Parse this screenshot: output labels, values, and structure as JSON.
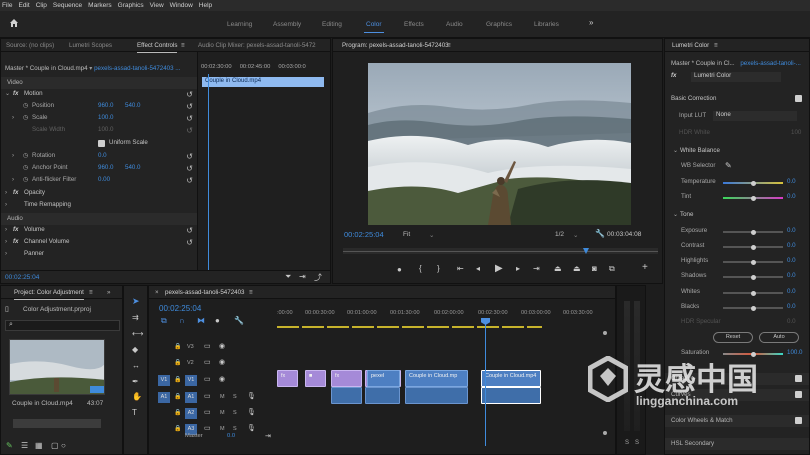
{
  "menu": [
    "File",
    "Edit",
    "Clip",
    "Sequence",
    "Markers",
    "Graphics",
    "View",
    "Window",
    "Help"
  ],
  "workspaces": [
    "Learning",
    "Assembly",
    "Editing",
    "Color",
    "Effects",
    "Audio",
    "Graphics",
    "Libraries"
  ],
  "workspace_active": "Color",
  "source_panel": {
    "tabs": [
      "Source: (no clips)",
      "Lumetri Scopes",
      "Effect Controls",
      "Audio Clip Mixer: pexels-assad-tanoli-5472"
    ],
    "master": "Master * Couple in Cloud.mp4",
    "seq": "pexels-assad-tanoli-5472403 ...",
    "mini_ruler": [
      "00:02:30:00",
      "00:02:45:00",
      "00:03:00:0"
    ],
    "mini_clip": "Couple in Cloud.mp4",
    "video_label": "Video",
    "audio_label": "Audio",
    "fx_label": "fx",
    "motion": "Motion",
    "position": "Position",
    "pos_x": "960.0",
    "pos_y": "540.0",
    "scale": "Scale",
    "scale_val": "100.0",
    "scale_width": "Scale Width",
    "scale_width_val": "100.0",
    "uniform_scale": "Uniform Scale",
    "rotation": "Rotation",
    "rotation_val": "0.0",
    "anchor": "Anchor Point",
    "anchor_x": "960.0",
    "anchor_y": "540.0",
    "antiflicker": "Anti-flicker Filter",
    "antiflicker_val": "0.00",
    "opacity": "Opacity",
    "time_remap": "Time Remapping",
    "volume": "Volume",
    "channel_volume": "Channel Volume",
    "panner": "Panner",
    "timecode": "00:02:25:04"
  },
  "program": {
    "title": "Program: pexels-assad-tanoli-5472403",
    "timecode": "00:02:25:04",
    "fit": "Fit",
    "resolution": "1/2",
    "duration": "00:03:04:08"
  },
  "project": {
    "title": "Project: Color Adjustment",
    "file": "Color Adjustment.prproj",
    "clip_name": "Couple in Cloud.mp4",
    "clip_duration": "43:07"
  },
  "timeline": {
    "title": "pexels-assad-tanoli-5472403",
    "timecode": "00:02:25:04",
    "ruler": [
      ":00:00",
      "00:00:30:00",
      "00:01:00:00",
      "00:01:30:00",
      "00:02:00:00",
      "00:02:30:00",
      "00:03:00:00",
      "00:03:30:00"
    ],
    "tracks_v": [
      "V3",
      "V2",
      "V1"
    ],
    "tracks_a": [
      "A1",
      "A2",
      "A3"
    ],
    "master": "Master",
    "master_val": "0.0",
    "clip1": "pexel",
    "clip2": "Couple in Cloud.mp4",
    "clip3": "Couple in Cloud.mp"
  },
  "lumetri": {
    "title": "Lumetri Color",
    "master": "Master * Couple in Cl...",
    "seq": "pexels-assad-tanoli-...",
    "fx_name": "Lumetri Color",
    "basic": "Basic Correction",
    "input_lut": "Input LUT",
    "lut_val": "None",
    "hdr_white": "HDR White",
    "hdr_val": "100",
    "white_balance": "White Balance",
    "wb_selector": "WB Selector",
    "temperature": "Temperature",
    "temp_val": "0.0",
    "tint": "Tint",
    "tint_val": "0.0",
    "tone": "Tone",
    "exposure": "Exposure",
    "exp_val": "0.0",
    "contrast": "Contrast",
    "con_val": "0.0",
    "highlights": "Highlights",
    "hi_val": "0.0",
    "shadows": "Shadows",
    "sh_val": "0.0",
    "whites": "Whites",
    "wh_val": "0.0",
    "blacks": "Blacks",
    "bl_val": "0.0",
    "hdr_specular": "HDR Specular",
    "spec_val": "0.0",
    "reset": "Reset",
    "auto": "Auto",
    "saturation": "Saturation",
    "sat_val": "100.0",
    "creative": "Creative",
    "curves": "Curves",
    "color_wheels": "Color Wheels & Match",
    "hsl": "HSL Secondary"
  },
  "watermark": {
    "cn": "灵感中国",
    "url": "lingganchina.com"
  },
  "colors": {
    "accent": "#3f8bdc",
    "clip_violet": "#a58ad8",
    "clip_blue": "#4d7fc2",
    "track_active": "#3b67a3"
  }
}
